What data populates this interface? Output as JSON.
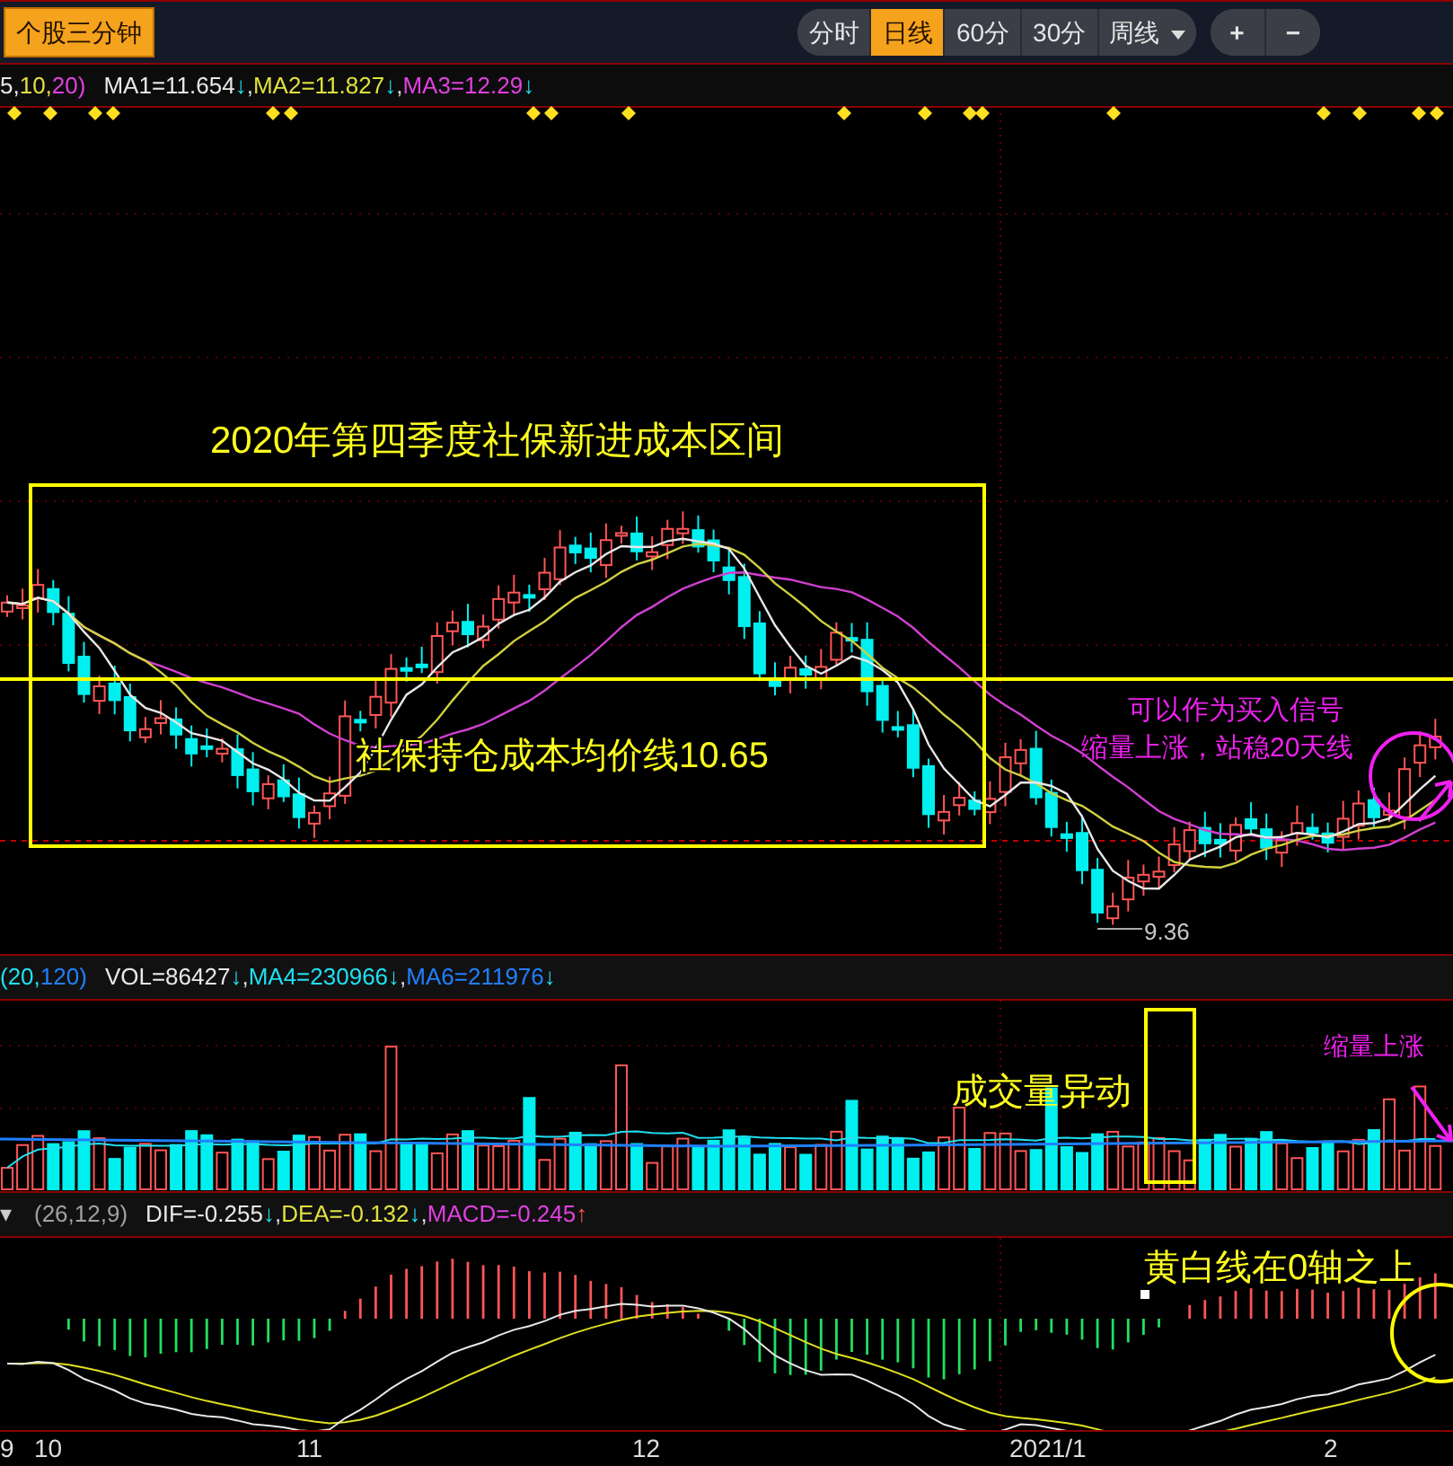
{
  "toolbar": {
    "stock_button": "个股三分钟",
    "periods": [
      {
        "label": "分时",
        "selected": false,
        "dropdown": false
      },
      {
        "label": "日线",
        "selected": true,
        "dropdown": false
      },
      {
        "label": "60分",
        "selected": false,
        "dropdown": false
      },
      {
        "label": "30分",
        "selected": false,
        "dropdown": false
      },
      {
        "label": "周线",
        "selected": false,
        "dropdown": true
      }
    ],
    "zoom_buttons": [
      "+",
      "−"
    ]
  },
  "price_legend": {
    "params": [
      {
        "text": "5,",
        "color": "#e8e8e8"
      },
      {
        "text": "10,",
        "color": "#e0e040"
      },
      {
        "text": "20)",
        "color": "#e040e0"
      }
    ],
    "items": [
      {
        "text": "MA1=11.654",
        "arrow": {
          "text": "↓",
          "color": "#20e0f0"
        },
        "color": "#e8e8e8"
      },
      {
        "sep": ",",
        "text": "MA2=11.827",
        "arrow": {
          "text": "↓",
          "color": "#20e0f0"
        },
        "color": "#e0e040"
      },
      {
        "sep": ",",
        "text": "MA3=12.29",
        "arrow": {
          "text": "↓",
          "color": "#20e0f0"
        },
        "color": "#e040e0"
      }
    ]
  },
  "main_chart": {
    "zone_label": "2020年第四季度社保新进成本区间",
    "cost_line_label": "社保持仓成本均价线10.65",
    "signal_notes": [
      "可以作为买入信号",
      "缩量上涨，站稳20天线"
    ],
    "low_label": "9.36"
  },
  "volume_legend": {
    "params": [
      {
        "text": "(20,",
        "color": "#20e0f0"
      },
      {
        "text": "120)",
        "color": "#2080ff"
      }
    ],
    "items": [
      {
        "text": "VOL=86427",
        "arrow": {
          "text": "↓",
          "color": "#20e0f0"
        },
        "color": "#e8e8e8"
      },
      {
        "sep": ",",
        "text": "MA4=230966",
        "arrow": {
          "text": "↓",
          "color": "#20e0f0"
        },
        "color": "#20e0f0"
      },
      {
        "sep": ",",
        "text": "MA6=211976",
        "arrow": {
          "text": "↓",
          "color": "#20e0f0"
        },
        "color": "#2080ff"
      }
    ]
  },
  "volume_chart": {
    "anomaly_label": "成交量异动",
    "note": "缩量上涨"
  },
  "macd_legend": {
    "menu_glyph": "▾",
    "params": [
      {
        "text": "(26,12,9)",
        "color": "#a0a0a0"
      }
    ],
    "items": [
      {
        "text": "DIF=-0.255",
        "arrow": {
          "text": "↓",
          "color": "#20e0f0"
        },
        "color": "#e8e8e8"
      },
      {
        "sep": ",",
        "text": "DEA=-0.132",
        "arrow": {
          "text": "↓",
          "color": "#20e0f0"
        },
        "color": "#e0e040"
      },
      {
        "sep": ",",
        "text": "MACD=-0.245",
        "arrow": {
          "text": "↑",
          "color": "#ff5050"
        },
        "color": "#e040e0"
      }
    ]
  },
  "macd_chart": {
    "note": "黄白线在0轴之上"
  },
  "x_axis": [
    "9",
    "10",
    "11",
    "12",
    "2021/1",
    "2"
  ]
}
